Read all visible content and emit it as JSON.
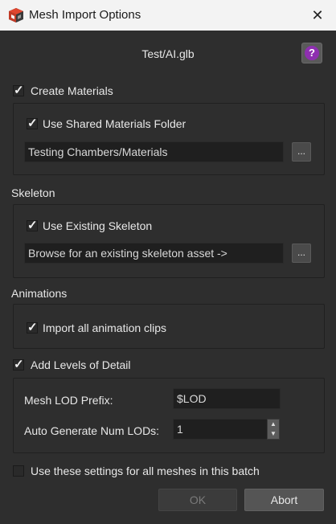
{
  "window": {
    "title": "Mesh Import Options",
    "close_glyph": "✕",
    "app_icon": "app-cube-icon"
  },
  "header": {
    "filename": "Test/AI.glb",
    "help_glyph": "?",
    "help_icon_color": "#8e2fb0"
  },
  "materials": {
    "create_label": "Create Materials",
    "create_checked": true,
    "shared_label": "Use Shared Materials Folder",
    "shared_checked": true,
    "folder_value": "Testing Chambers/Materials",
    "browse_label": "..."
  },
  "skeleton": {
    "section_label": "Skeleton",
    "use_existing_label": "Use Existing Skeleton",
    "use_existing_checked": true,
    "browse_placeholder": "Browse for an existing skeleton asset ->",
    "browse_label": "..."
  },
  "animations": {
    "section_label": "Animations",
    "import_all_label": "Import all animation clips",
    "import_all_checked": true
  },
  "lod": {
    "add_label": "Add Levels of Detail",
    "add_checked": true,
    "prefix_label": "Mesh LOD Prefix:",
    "prefix_value": "$LOD",
    "auto_label": "Auto Generate Num LODs:",
    "auto_value": "1",
    "spin_up": "▲",
    "spin_down": "▼"
  },
  "batch": {
    "label": "Use these settings for all meshes in this batch",
    "checked": false
  },
  "buttons": {
    "ok": "OK",
    "ok_enabled": false,
    "abort": "Abort"
  },
  "check_glyph": "✓"
}
